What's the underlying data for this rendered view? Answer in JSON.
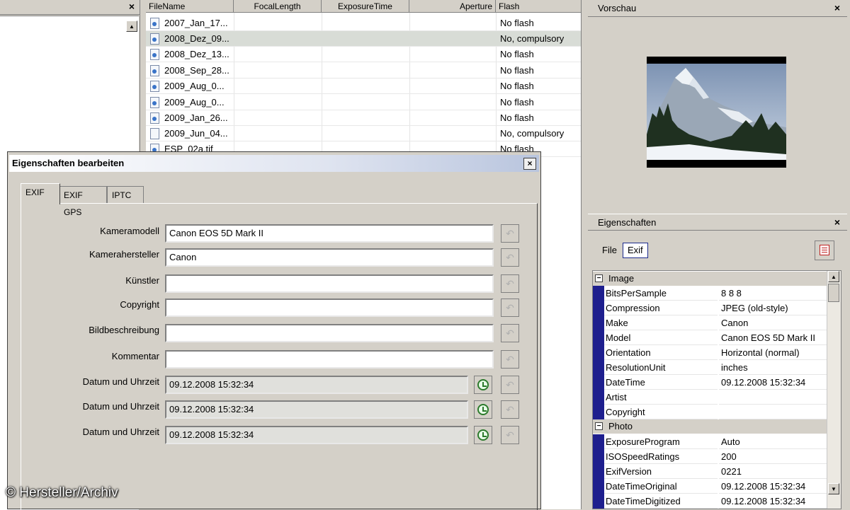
{
  "left_panel": {
    "close": "×"
  },
  "file_list": {
    "columns": [
      "FileName",
      "FocalLength",
      "ExposureTime",
      "Aperture",
      "Flash"
    ],
    "rows": [
      {
        "name": "2007_Jan_17...",
        "flash": "No flash",
        "icon": "image-file-icon"
      },
      {
        "name": "2008_Dez_09...",
        "flash": "No, compulsory",
        "icon": "image-file-icon",
        "selected": true
      },
      {
        "name": "2008_Dez_13...",
        "flash": "No flash",
        "icon": "image-file-icon"
      },
      {
        "name": "2008_Sep_28...",
        "flash": "No flash",
        "icon": "image-file-icon"
      },
      {
        "name": "2009_Aug_0...",
        "flash": "No flash",
        "icon": "image-file-icon"
      },
      {
        "name": "2009_Aug_0...",
        "flash": "No flash",
        "icon": "image-file-icon"
      },
      {
        "name": "2009_Jan_26...",
        "flash": "No flash",
        "icon": "image-file-icon"
      },
      {
        "name": "2009_Jun_04...",
        "flash": "No, compulsory",
        "icon": "blank-file-icon"
      },
      {
        "name": "ESP_02a.tif",
        "flash": "No flash",
        "icon": "image-file-icon"
      }
    ]
  },
  "preview_panel": {
    "title": "Vorschau",
    "close": "×"
  },
  "properties_panel": {
    "title": "Eigenschaften",
    "close": "×",
    "tab_file": "File",
    "tab_exif": "Exif",
    "categories": [
      {
        "name": "Image",
        "rows": [
          {
            "key": "BitsPerSample",
            "value": "8 8 8"
          },
          {
            "key": "Compression",
            "value": "JPEG (old-style)"
          },
          {
            "key": "Make",
            "value": "Canon"
          },
          {
            "key": "Model",
            "value": "Canon EOS 5D Mark II"
          },
          {
            "key": "Orientation",
            "value": "Horizontal (normal)"
          },
          {
            "key": "ResolutionUnit",
            "value": "inches"
          },
          {
            "key": "DateTime",
            "value": "09.12.2008 15:32:34"
          },
          {
            "key": "Artist",
            "value": ""
          },
          {
            "key": "Copyright",
            "value": ""
          }
        ]
      },
      {
        "name": "Photo",
        "rows": [
          {
            "key": "ExposureProgram",
            "value": "Auto"
          },
          {
            "key": "ISOSpeedRatings",
            "value": "200"
          },
          {
            "key": "ExifVersion",
            "value": "0221"
          },
          {
            "key": "DateTimeOriginal",
            "value": "09.12.2008 15:32:34"
          },
          {
            "key": "DateTimeDigitized",
            "value": "09.12.2008 15:32:34"
          }
        ]
      }
    ]
  },
  "dialog": {
    "title": "Eigenschaften bearbeiten",
    "close": "×",
    "tabs": [
      "EXIF",
      "EXIF GPS",
      "IPTC"
    ],
    "fields": [
      {
        "label": "Kameramodell",
        "value": "Canon EOS 5D Mark II"
      },
      {
        "label": "Kamerahersteller",
        "value": "Canon"
      },
      {
        "label": "Künstler",
        "value": ""
      },
      {
        "label": "Copyright",
        "value": ""
      },
      {
        "label": "Bildbeschreibung",
        "value": ""
      },
      {
        "label": "Kommentar",
        "value": ""
      }
    ],
    "date_fields": [
      {
        "label": "Datum und Uhrzeit",
        "value": "09.12.2008 15:32:34"
      },
      {
        "label": "Datum und Uhrzeit",
        "value": "09.12.2008 15:32:34"
      },
      {
        "label": "Datum und Uhrzeit",
        "value": "09.12.2008 15:32:34"
      }
    ]
  },
  "credit": "© Hersteller/Archiv"
}
